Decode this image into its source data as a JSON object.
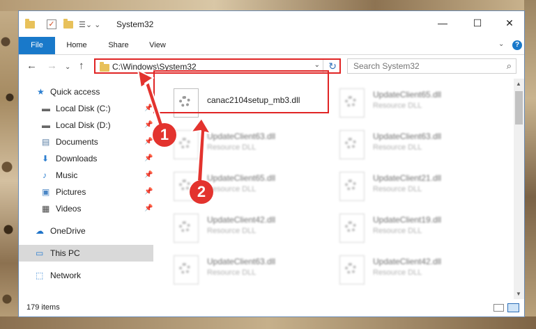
{
  "window": {
    "title": "System32",
    "minimize": "—",
    "maximize": "☐",
    "close": "✕"
  },
  "ribbon": {
    "tabs": [
      "File",
      "Home",
      "Share",
      "View"
    ],
    "help": "?",
    "expand": "⌄"
  },
  "nav": {
    "back": "←",
    "forward": "→",
    "recent": "⌄",
    "up": "↑"
  },
  "address": {
    "path": "C:\\Windows\\System32",
    "dropdown": "⌄",
    "refresh": "↻"
  },
  "search": {
    "placeholder": "Search System32",
    "icon": "⌕"
  },
  "sidebar": {
    "items": [
      {
        "label": "Quick access",
        "icon": "★"
      },
      {
        "label": "Local Disk (C:)",
        "icon": "▬"
      },
      {
        "label": "Local Disk (D:)",
        "icon": "▬"
      },
      {
        "label": "Documents",
        "icon": "▤"
      },
      {
        "label": "Downloads",
        "icon": "⬇"
      },
      {
        "label": "Music",
        "icon": "♪"
      },
      {
        "label": "Pictures",
        "icon": "▣"
      },
      {
        "label": "Videos",
        "icon": "▦"
      },
      {
        "label": "OneDrive",
        "icon": "☁"
      },
      {
        "label": "This PC",
        "icon": "▭"
      },
      {
        "label": "Network",
        "icon": "⬚"
      }
    ],
    "pin": "📌"
  },
  "files": [
    {
      "name": "canac2104setup_mb3.dll",
      "type": ""
    },
    {
      "name": "UpdateClient65.dll",
      "type": "Resource DLL"
    },
    {
      "name": "UpdateClient63.dll",
      "type": "Resource DLL"
    },
    {
      "name": "UpdateClient63.dll",
      "type": "Resource DLL"
    },
    {
      "name": "UpdateClient65.dll",
      "type": "Resource DLL"
    },
    {
      "name": "UpdateClient21.dll",
      "type": "Resource DLL"
    },
    {
      "name": "UpdateClient42.dll",
      "type": "Resource DLL"
    },
    {
      "name": "UpdateClient19.dll",
      "type": "Resource DLL"
    },
    {
      "name": "UpdateClient63.dll",
      "type": "Resource DLL"
    },
    {
      "name": "UpdateClient42.dll",
      "type": "Resource DLL"
    }
  ],
  "status": {
    "items": "179 items"
  },
  "annotations": {
    "marker1": "1",
    "marker2": "2",
    "accent": "#e3332e"
  }
}
